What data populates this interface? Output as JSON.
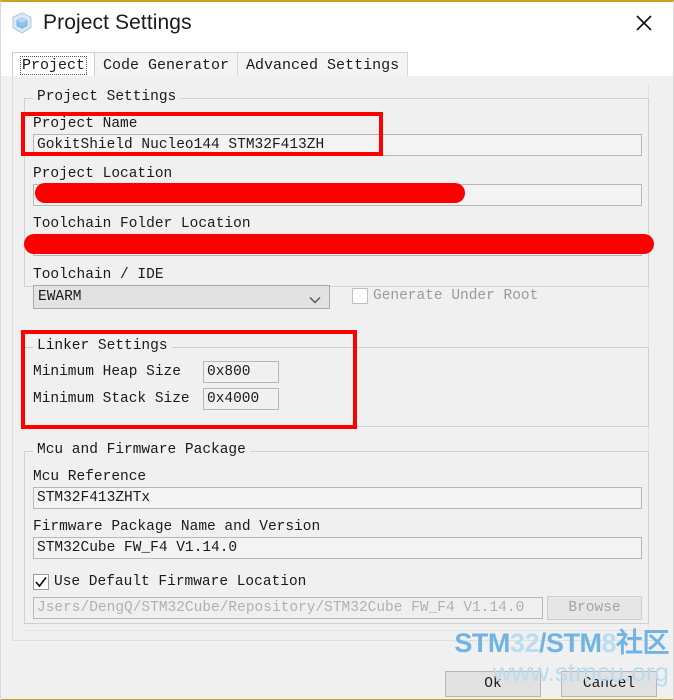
{
  "window": {
    "title": "Project Settings",
    "icon": "cube-icon",
    "close_label": "✕"
  },
  "tabs": [
    {
      "label": "Project",
      "selected": true
    },
    {
      "label": "Code Generator",
      "selected": false
    },
    {
      "label": "Advanced Settings",
      "selected": false
    }
  ],
  "project_settings": {
    "group_title": "Project Settings",
    "project_name_label": "Project Name",
    "project_name_value": "GokitShield Nucleo144 STM32F413ZH",
    "project_location_label": "Project Location",
    "project_location_value": "",
    "project_location_redacted": true,
    "toolchain_folder_label": "Toolchain Folder Location",
    "toolchain_folder_value": "",
    "toolchain_folder_redacted": true,
    "toolchain_ide_label": "Toolchain / IDE",
    "toolchain_ide_value": "EWARM",
    "generate_under_root_label": "Generate Under Root",
    "generate_under_root_checked": false,
    "generate_under_root_disabled": true
  },
  "linker_settings": {
    "group_title": "Linker Settings",
    "heap_label": "Minimum Heap Size",
    "heap_value": "0x800",
    "stack_label": "Minimum Stack Size",
    "stack_value": "0x4000"
  },
  "mcu_firmware": {
    "group_title": "Mcu and Firmware Package",
    "mcu_reference_label": "Mcu Reference",
    "mcu_reference_value": "STM32F413ZHTx",
    "firmware_package_label": "Firmware Package Name and Version",
    "firmware_package_value": "STM32Cube FW_F4 V1.14.0",
    "use_default_label": "Use Default Firmware Location",
    "use_default_checked": true,
    "firmware_path_value": "Jsers/DengQ/STM32Cube/Repository/STM32Cube FW_F4 V1.14.0",
    "browse_label": "Browse",
    "browse_disabled": true
  },
  "dialog_buttons": {
    "ok_label": "Ok",
    "cancel_label": "Cancel"
  },
  "watermark": {
    "line1_part1": "STM",
    "line1_part2": "32",
    "line1_part3": "/STM",
    "line1_part4": "8",
    "line1_part5": "社区",
    "line2": "www.stmcu.org"
  },
  "annotations": {
    "highlight_color": "#ff0000",
    "redaction_color": "#fc0000"
  }
}
